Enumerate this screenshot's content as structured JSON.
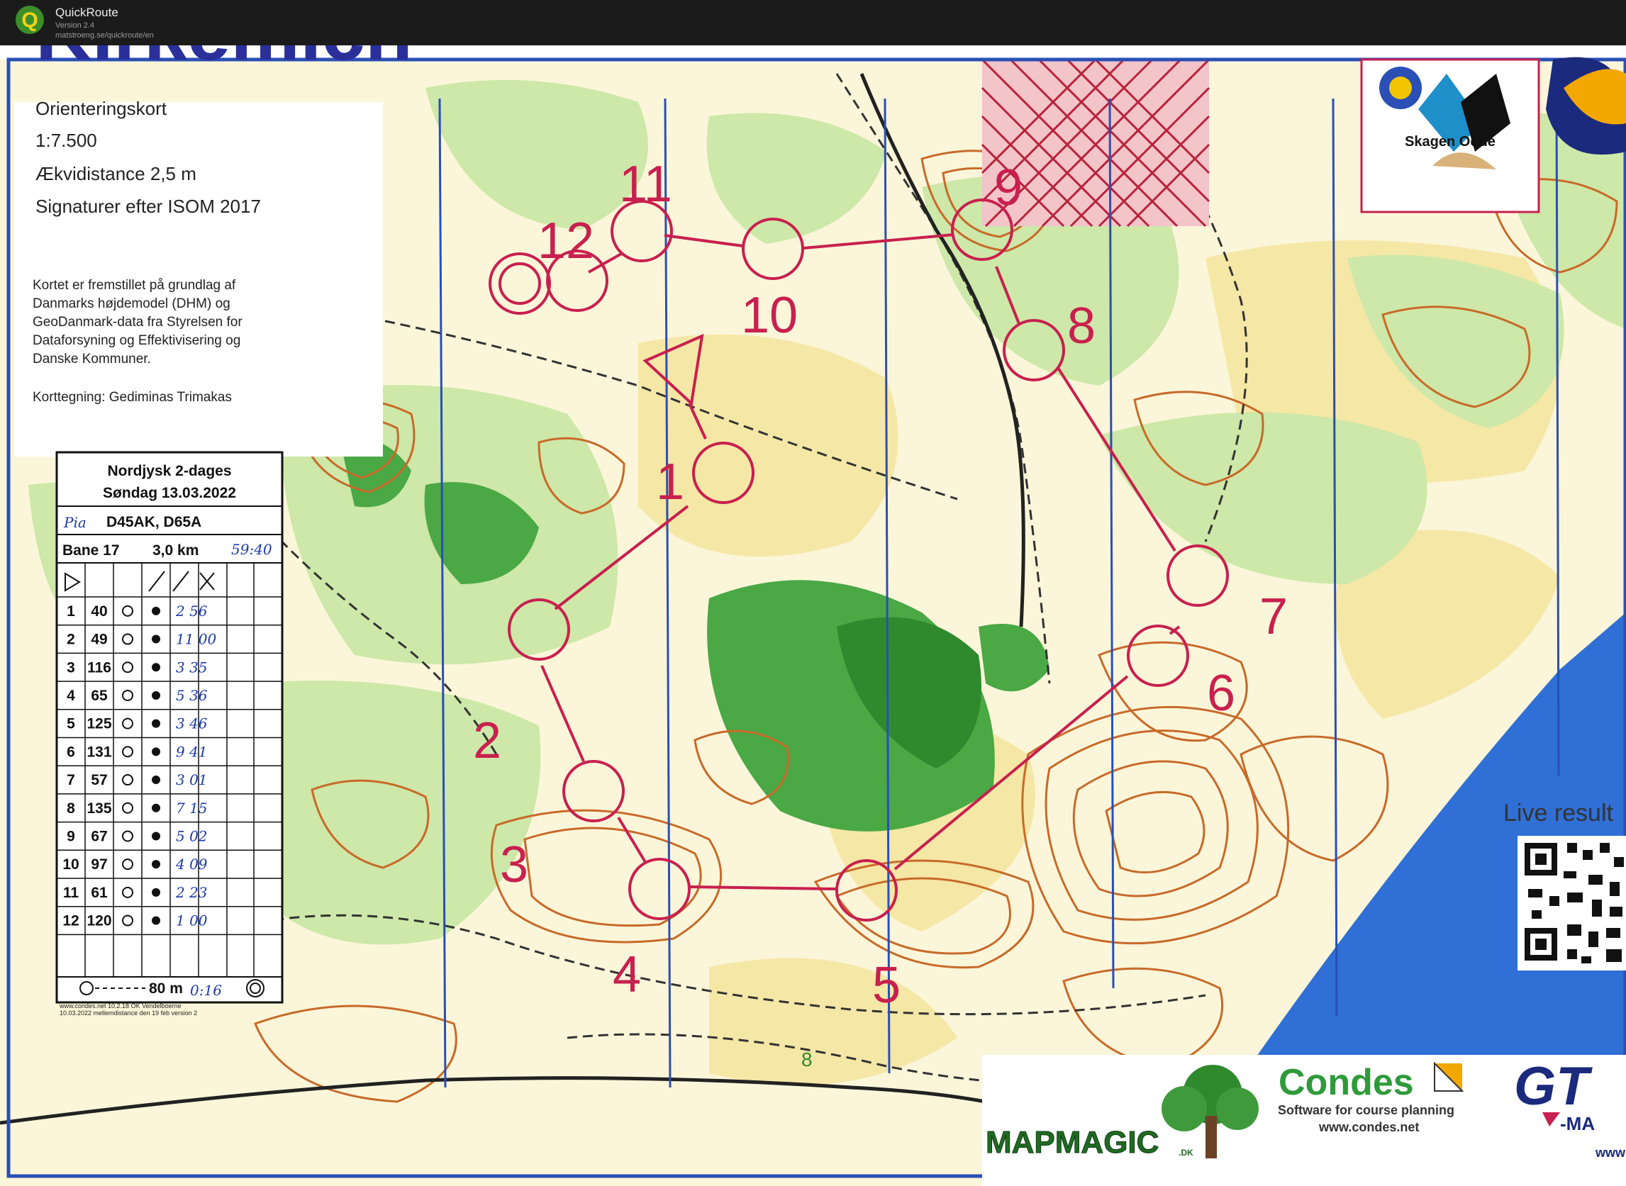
{
  "app": {
    "name": "QuickRoute",
    "version": "Version 2.4",
    "url": "matstroeng.se/quickroute/en"
  },
  "map": {
    "title_fragment": "Kirkemich",
    "info_lines": [
      "Orienteringskort",
      "1:7.500",
      "Ækvidistance 2,5 m",
      "Signaturer efter ISOM 2017"
    ],
    "source_lines": [
      "Kortet er fremstillet på grundlag af",
      "Danmarks højdemodel (DHM) og",
      "GeoDanmark-data fra Styrelsen for",
      "Dataforsyning og Effektivisering og",
      "Danske Kommuner."
    ],
    "cartographer": "Korttegning: Gediminas Trimakas",
    "club_logo_label": "Skagen Odde",
    "live_results": "Live result",
    "sponsors": {
      "mapmagic": "MAPMAGIC",
      "mapmagic_suffix": ".DK",
      "condes_name": "Condes",
      "condes_tagline": "Software for course planning",
      "condes_url": "www.condes.net",
      "gt_label": "GT",
      "gt_sub": "-MA",
      "gt_url": "www"
    },
    "colors": {
      "course": "#c8204f",
      "forest_light": "#c9e6a4",
      "forest_dark": "#3f9a3c",
      "open_land": "#f6e9b0",
      "contour": "#c86a2a",
      "water": "#2f6fd6",
      "magnetic_north": "#2a4fb5"
    },
    "controls": [
      {
        "code": "1",
        "label": "1"
      },
      {
        "code": "2",
        "label": "2"
      },
      {
        "code": "3",
        "label": "3"
      },
      {
        "code": "4",
        "label": "4"
      },
      {
        "code": "5",
        "label": "5"
      },
      {
        "code": "6",
        "label": "6"
      },
      {
        "code": "7",
        "label": "7"
      },
      {
        "code": "8",
        "label": "8"
      },
      {
        "code": "9",
        "label": "9"
      },
      {
        "code": "10",
        "label": "10"
      },
      {
        "code": "11",
        "label": "11"
      },
      {
        "code": "12",
        "label": "12"
      }
    ],
    "trail": "8"
  },
  "control_card": {
    "event": "Nordjysk 2-dages",
    "date": "Søndag 13.03.2022",
    "runner_name": "Pia",
    "classes": "D45AK, D65A",
    "course": "Bane 17",
    "length": "3,0 km",
    "total_time": "59:40",
    "rows": [
      {
        "n": "1",
        "code": "40",
        "time": "2 56"
      },
      {
        "n": "2",
        "code": "49",
        "time": "11 00"
      },
      {
        "n": "3",
        "code": "116",
        "time": "3 35"
      },
      {
        "n": "4",
        "code": "65",
        "time": "5 36"
      },
      {
        "n": "5",
        "code": "125",
        "time": "3 46"
      },
      {
        "n": "6",
        "code": "131",
        "time": "9 41"
      },
      {
        "n": "7",
        "code": "57",
        "time": "3 01"
      },
      {
        "n": "8",
        "code": "135",
        "time": "7 15"
      },
      {
        "n": "9",
        "code": "67",
        "time": "5 02"
      },
      {
        "n": "10",
        "code": "97",
        "time": "4 09"
      },
      {
        "n": "11",
        "code": "61",
        "time": "2 23"
      },
      {
        "n": "12",
        "code": "120",
        "time": "1 00"
      }
    ],
    "finish_distance": "80 m",
    "finish_time": "0:16",
    "footer_1": "www.condes.net 10.2.18 OK Vendelboerne",
    "footer_2": "10.03.2022 mellemdistance den 19 feb version 2"
  }
}
